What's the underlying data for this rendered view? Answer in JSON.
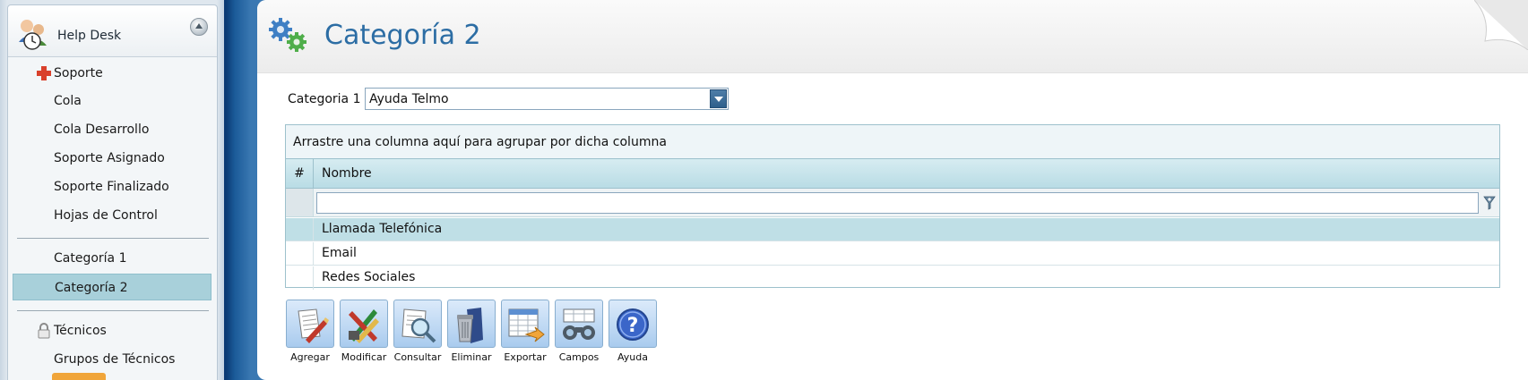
{
  "sidebar": {
    "title": "Help Desk",
    "items": [
      {
        "label": "Soporte",
        "icon": "red-cross-icon"
      },
      {
        "label": "Cola"
      },
      {
        "label": "Cola Desarrollo"
      },
      {
        "label": "Soporte Asignado"
      },
      {
        "label": "Soporte Finalizado"
      },
      {
        "label": "Hojas de Control"
      },
      {
        "label": "Categoría 1"
      },
      {
        "label": "Categoría 2",
        "selected": true
      },
      {
        "label": "Técnicos",
        "icon": "lock-icon"
      },
      {
        "label": "Grupos de Técnicos"
      }
    ]
  },
  "page": {
    "title": "Categoría 2"
  },
  "filter": {
    "label": "Categoria 1",
    "selected_value": "Ayuda Telmo"
  },
  "grid": {
    "group_hint": "Arrastre una columna aquí para agrupar por dicha columna",
    "columns": [
      "#",
      "Nombre"
    ],
    "filter_value": "",
    "rows": [
      {
        "nombre": "Llamada Telefónica",
        "selected": true
      },
      {
        "nombre": "Email"
      },
      {
        "nombre": "Redes Sociales"
      }
    ]
  },
  "toolbar": {
    "buttons": [
      {
        "label": "Agregar",
        "icon": "add-document-icon"
      },
      {
        "label": "Modificar",
        "icon": "edit-pencils-icon"
      },
      {
        "label": "Consultar",
        "icon": "magnifier-document-icon"
      },
      {
        "label": "Eliminar",
        "icon": "trash-bin-icon"
      },
      {
        "label": "Exportar",
        "icon": "export-spreadsheet-icon"
      },
      {
        "label": "Campos",
        "icon": "binoculars-icon"
      },
      {
        "label": "Ayuda",
        "icon": "help-question-icon"
      }
    ]
  },
  "colors": {
    "title_blue": "#2c6da4",
    "selected_row": "#bfdfe6",
    "sidebar_selected": "#a8d0da"
  }
}
